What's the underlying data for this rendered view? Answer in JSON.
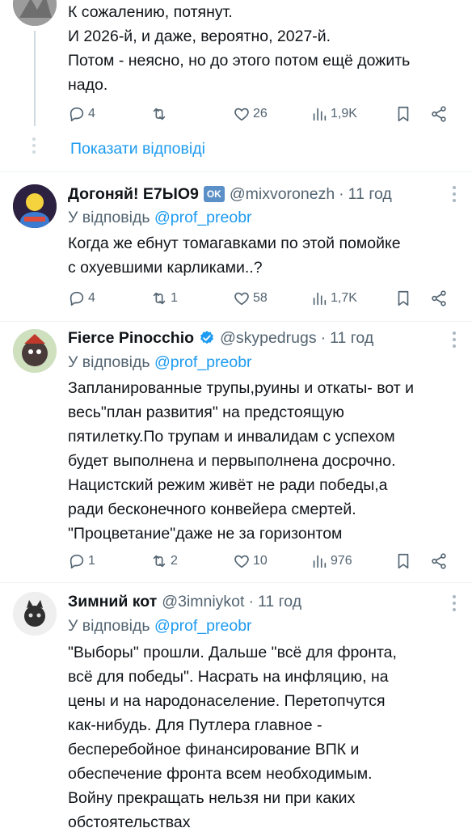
{
  "tweets": [
    {
      "text": "К сожалению, потянут.\nИ 2026-й, и даже, вероятно, 2027-й.\nПотом - неясно, но до этого потом ещё дожить\nнадо.",
      "replies": "4",
      "retweets": "",
      "likes": "26",
      "views": "1,9K",
      "show_replies": "Показати відповіді"
    },
    {
      "name": "Догоняй! Е7ЫО9",
      "badge": "OK",
      "handle": "@mixvoronezh",
      "time": "11 год",
      "reply_prefix": "У відповідь",
      "reply_to": "@prof_preobr",
      "text": "Когда же ебнут томагавками по этой помойке\nс охуевшими карликами..?",
      "replies": "4",
      "retweets": "1",
      "likes": "58",
      "views": "1,7K"
    },
    {
      "name": "Fierce Pinocchio",
      "handle": "@skypedrugs",
      "time": "11 год",
      "reply_prefix": "У відповідь",
      "reply_to": "@prof_preobr",
      "text": "Запланированные трупы,руины и откаты- вот и\nвесь\"план развития\" на предстоящую\nпятилетку.По трупам и инвалидам с успехом\nбудет выполнена и первыполнена досрочно.\nНацистский режим живёт не ради победы,а\nради бесконечного конвейера смертей.\n\"Процветание\"даже не за горизонтом",
      "replies": "1",
      "retweets": "2",
      "likes": "10",
      "views": "976"
    },
    {
      "name": "Зимний кот",
      "handle": "@3imniykot",
      "time": "11 год",
      "reply_prefix": "У відповідь",
      "reply_to": "@prof_preobr",
      "text": "\"Выборы\" прошли. Дальше \"всё для фронта,\nвсё для победы\". Насрать на инфляцию, на\nцены и на народонаселение. Перетопчутся\nкак-нибудь. Для Путлера главное -\nбесперебойное финансирование ВПК и\nобеспечение фронта всем необходимым.\nВойну прекращать нельзя ни при каких\nобстоятельствах"
    }
  ],
  "colors": {
    "link": "#1d9bf0",
    "muted": "#536471",
    "verified": "#1d9bf0"
  },
  "icons": [
    "reply-icon",
    "retweet-icon",
    "like-icon",
    "views-icon",
    "bookmark-icon",
    "share-icon",
    "more-icon",
    "verified-icon"
  ]
}
